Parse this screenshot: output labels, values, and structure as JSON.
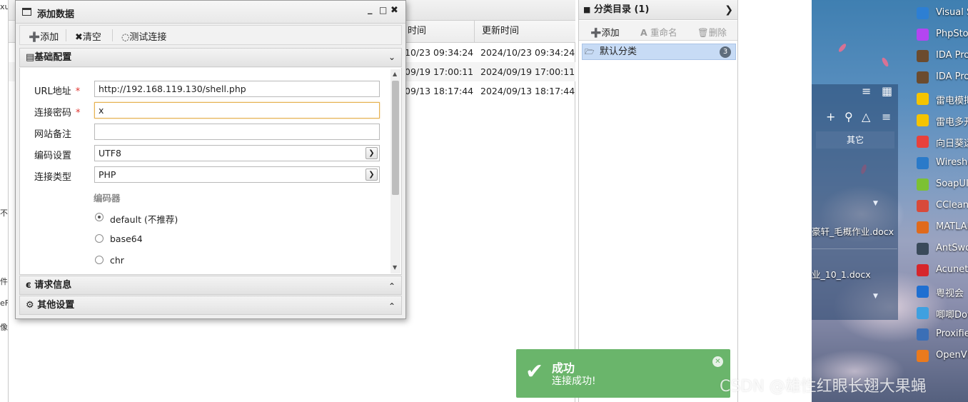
{
  "left_strip": {
    "fragments": [
      "xu",
      "不载",
      "件",
      "eFi",
      "像"
    ]
  },
  "main_table": {
    "columns": [
      "时间",
      "更新时间"
    ],
    "rows": [
      {
        "created": "10/23 09:34:24",
        "updated": "2024/10/23 09:34:24"
      },
      {
        "created": "09/19 17:00:11",
        "updated": "2024/09/19 17:00:11"
      },
      {
        "created": "09/13 18:17:44",
        "updated": "2024/09/13 18:17:44"
      }
    ]
  },
  "category_panel": {
    "title": "分类目录 (1)",
    "toolbar": {
      "add": "添加",
      "rename": "重命名",
      "delete": "删除"
    },
    "items": [
      {
        "label": "默认分类",
        "count": "3"
      }
    ]
  },
  "dialog": {
    "title": "添加数据",
    "toolbar": {
      "add": "添加",
      "clear": "清空",
      "test": "测试连接"
    },
    "sections": {
      "basic": "基础配置",
      "request": "请求信息",
      "other": "其他设置"
    },
    "form": {
      "url_label": "URL地址",
      "url_value": "http://192.168.119.130/shell.php",
      "password_label": "连接密码",
      "password_value": "x",
      "note_label": "网站备注",
      "note_value": "",
      "encoding_label": "编码设置",
      "encoding_value": "UTF8",
      "type_label": "连接类型",
      "type_value": "PHP",
      "encoder_title": "编码器",
      "encoders": [
        "default (不推荐)",
        "base64",
        "chr"
      ],
      "required_mark": "*"
    }
  },
  "desktop": {
    "panel_tab": "其它",
    "files": [
      "豪轩_毛概作业.docx",
      "业_10_1.docx"
    ],
    "apps": [
      {
        "label": "Visual S",
        "color": "#2d7fd3"
      },
      {
        "label": "PhpStorm",
        "color": "#b345f1"
      },
      {
        "label": "IDA Pro",
        "color": "#6b4b2e"
      },
      {
        "label": "IDA Pro",
        "color": "#6b4b2e"
      },
      {
        "label": "雷电模拟",
        "color": "#f5c400"
      },
      {
        "label": "雷电多开",
        "color": "#f5c400"
      },
      {
        "label": "向日葵远",
        "color": "#e8413c"
      },
      {
        "label": "Wiresha",
        "color": "#2a7ac9"
      },
      {
        "label": "SoapUI",
        "color": "#7cc133"
      },
      {
        "label": "CCleane",
        "color": "#d84a3a"
      },
      {
        "label": "MATLAB",
        "color": "#e06a1b"
      },
      {
        "label": "AntSwor",
        "color": "#3a4a5a"
      },
      {
        "label": "Acunetix",
        "color": "#d6262b"
      },
      {
        "label": "粤视会",
        "color": "#1f6fd1"
      },
      {
        "label": "唧唧Dow",
        "color": "#3fa0e0"
      },
      {
        "label": "Proxifier",
        "color": "#3b6fb6"
      },
      {
        "label": "OpenVP",
        "color": "#ea7a1d"
      }
    ]
  },
  "toast": {
    "title": "成功",
    "message": "连接成功!",
    "color": "#6ab56b"
  },
  "watermark": "CSDN @雄性红眼长翅大果蝇"
}
